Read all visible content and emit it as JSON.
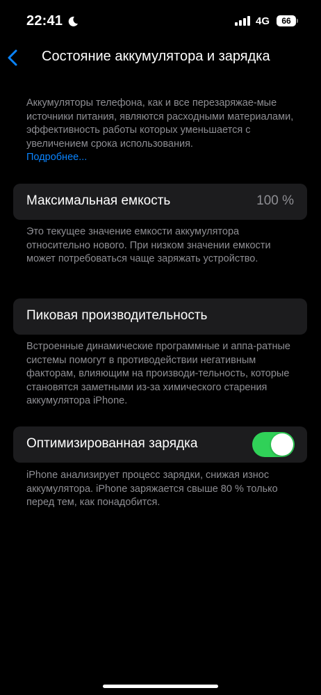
{
  "status_bar": {
    "time": "22:41",
    "network": "4G",
    "battery_level": "66"
  },
  "nav": {
    "title": "Состояние аккумулятора и зарядка"
  },
  "intro": {
    "text": "Аккумуляторы телефона, как и все перезаряжае-мые источники питания, являются расходными материалами, эффективность работы которых уменьшается с увеличением срока использования.",
    "link": "Подробнее..."
  },
  "max_capacity": {
    "label": "Максимальная емкость",
    "value": "100 %",
    "footer": "Это текущее значение емкости аккумулятора относительно нового. При низком значении емкости может потребоваться чаще заряжать устройство."
  },
  "peak_performance": {
    "label": "Пиковая производительность",
    "footer": "Встроенные динамические программные и аппа-ратные системы помогут в противодействии негативным факторам, влияющим на производи-тельность, которые становятся заметными из-за химического старения аккумулятора iPhone."
  },
  "optimized_charging": {
    "label": "Оптимизированная зарядка",
    "enabled": true,
    "footer": "iPhone анализирует процесс зарядки, снижая износ аккумулятора. iPhone заряжается свыше 80 % только перед тем, как понадобится."
  },
  "colors": {
    "background": "#000000",
    "cell": "#1c1c1e",
    "secondary_text": "#8e8e93",
    "link": "#0a84ff",
    "toggle_on": "#30d158"
  }
}
